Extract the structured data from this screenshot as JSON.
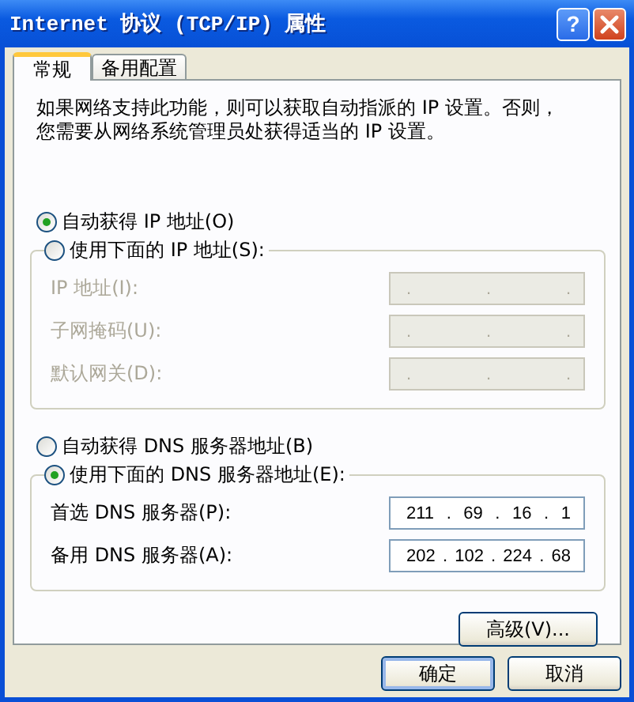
{
  "window": {
    "title": "Internet 协议 (TCP/IP) 属性",
    "help_button": "?"
  },
  "tabs": [
    {
      "label": "常规",
      "selected": true
    },
    {
      "label": "备用配置",
      "selected": false
    }
  ],
  "description": "如果网络支持此功能，则可以获取自动指派的 IP 设置。否则，您需要从网络系统管理员处获得适当的 IP 设置。",
  "sections": [
    {
      "auto_option": {
        "label": "自动获得 IP 地址(O)",
        "selected": true
      },
      "manual_option": {
        "label": "使用下面的 IP 地址(S):",
        "selected": false
      },
      "fields": [
        {
          "label": "IP 地址(I):",
          "disabled": true,
          "parts": [
            ".",
            ".",
            "."
          ]
        },
        {
          "label": "子网掩码(U):",
          "disabled": true,
          "parts": [
            ".",
            ".",
            "."
          ]
        },
        {
          "label": "默认网关(D):",
          "disabled": true,
          "parts": [
            ".",
            ".",
            "."
          ]
        }
      ]
    },
    {
      "auto_option": {
        "label": "自动获得 DNS 服务器地址(B)",
        "selected": false
      },
      "manual_option": {
        "label": "使用下面的 DNS 服务器地址(E):",
        "selected": true
      },
      "fields": [
        {
          "label": "首选 DNS 服务器(P):",
          "disabled": false,
          "parts": [
            "211",
            ".",
            "69",
            ".",
            "16",
            ".",
            "1"
          ]
        },
        {
          "label": "备用 DNS 服务器(A):",
          "disabled": false,
          "parts": [
            "202",
            ".",
            "102",
            ".",
            "224",
            ".",
            "68"
          ]
        }
      ]
    }
  ],
  "advanced_button": "高级(V)...",
  "buttons": [
    "确定",
    "取消"
  ]
}
